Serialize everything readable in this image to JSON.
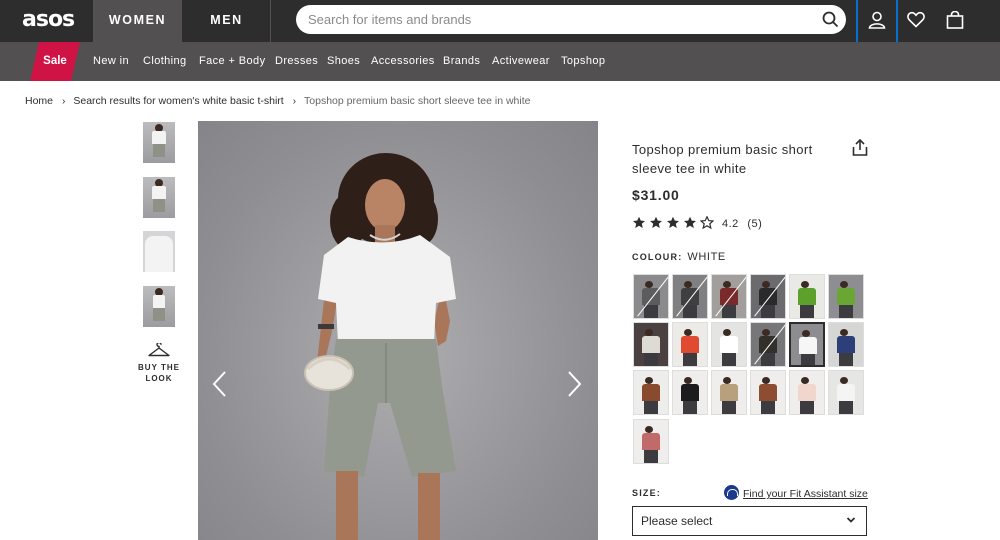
{
  "header": {
    "logo": "asos",
    "tabs": [
      {
        "label": "WOMEN",
        "active": true
      },
      {
        "label": "MEN",
        "active": false
      }
    ],
    "search_placeholder": "Search for items and brands",
    "icons": [
      "search-icon",
      "account-icon",
      "heart-icon",
      "bag-icon"
    ]
  },
  "nav": {
    "sale": "Sale",
    "items": [
      "New in",
      "Clothing",
      "Face + Body",
      "Dresses",
      "Shoes",
      "Accessories",
      "Brands",
      "Activewear",
      "Topshop"
    ]
  },
  "breadcrumb": [
    "Home",
    "Search results for women's white basic t-shirt",
    "Topshop premium basic short sleeve tee in white"
  ],
  "gallery": {
    "buy_the_look": "BUY THE LOOK"
  },
  "product": {
    "title": "Topshop premium basic short sleeve tee in white",
    "price": "$31.00",
    "rating": 4.2,
    "rating_text": "4.2",
    "review_count": "(5)",
    "colour_label": "COLOUR:",
    "colour_value": "WHITE",
    "swatches": [
      {
        "tee": "#5c5c5e",
        "bg": "#8b8b8d",
        "unavailable": true
      },
      {
        "tee": "#3f3f42",
        "bg": "#808083",
        "unavailable": true
      },
      {
        "tee": "#7a2a2a",
        "bg": "#a19e9c",
        "unavailable": true
      },
      {
        "tee": "#2a2a2c",
        "bg": "#6b6b6e",
        "unavailable": true
      },
      {
        "tee": "#5ea02c",
        "bg": "#e9e9e6",
        "unavailable": false
      },
      {
        "tee": "#6aa634",
        "bg": "#8e8e92",
        "unavailable": false
      },
      {
        "tee": "#dedbd5",
        "bg": "#4a4140",
        "unavailable": false
      },
      {
        "tee": "#e04a30",
        "bg": "#ecebe8",
        "unavailable": false
      },
      {
        "tee": "#ffffff",
        "bg": "#e4e4e2",
        "unavailable": false
      },
      {
        "tee": "#33302c",
        "bg": "#777678",
        "unavailable": true
      },
      {
        "tee": "#f6f6f6",
        "bg": "#8d8c90",
        "unavailable": false
      },
      {
        "tee": "#2c3f7a",
        "bg": "#d6d6d4",
        "unavailable": false
      },
      {
        "tee": "#8a4a2e",
        "bg": "#ededeb",
        "unavailable": false
      },
      {
        "tee": "#1c1c1e",
        "bg": "#efeeec",
        "unavailable": false
      },
      {
        "tee": "#b8a07a",
        "bg": "#efeeec",
        "unavailable": false
      },
      {
        "tee": "#8e4c30",
        "bg": "#efeeec",
        "unavailable": false
      },
      {
        "tee": "#f0d6cc",
        "bg": "#efeeec",
        "unavailable": false
      },
      {
        "tee": "#f4f4f4",
        "bg": "#e6e6e4",
        "unavailable": false
      },
      {
        "tee": "#c06a6a",
        "bg": "#efeeec",
        "unavailable": false
      }
    ],
    "selected_swatch": 10,
    "size_label": "SIZE:",
    "fit_assistant": "Find your Fit Assistant size",
    "size_placeholder": "Please select"
  },
  "colors": {
    "header_bg": "#2d2d2d",
    "nav_bg": "#525050",
    "sale_red": "#d01345",
    "focus_blue": "#0770cf"
  }
}
